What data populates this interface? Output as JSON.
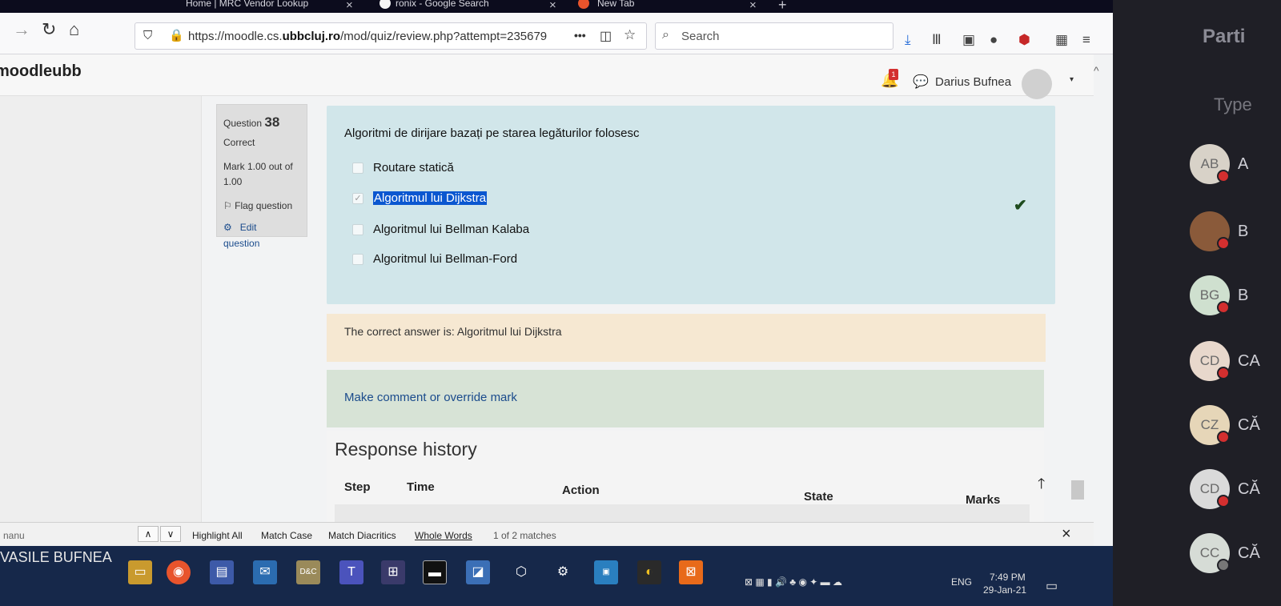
{
  "browser": {
    "tabs": [
      {
        "label": "Home | MRC Vendor Lookup"
      },
      {
        "label": "ronix - Google Search"
      },
      {
        "label": "New Tab"
      }
    ],
    "url_prefix": "https://moodle.cs.",
    "url_domain": "ubbcluj.ro",
    "url_suffix": "/mod/quiz/review.php?attempt=235679",
    "search_placeholder": "Search",
    "more_label": "•••"
  },
  "moodle": {
    "brand": "moodleubb",
    "user_name": "Darius Bufnea",
    "notification_count": "1"
  },
  "question_info": {
    "question_label": "Question",
    "question_number": "38",
    "state": "Correct",
    "mark_line1": "Mark 1.00 out of",
    "mark_line2": "1.00",
    "flag_label": "Flag question",
    "edit_line1": "Edit",
    "edit_line2": "question"
  },
  "question": {
    "text": "Algoritmi de dirijare bazați pe starea legăturilor folosesc",
    "answers": [
      {
        "label": "Routare statică",
        "checked": false
      },
      {
        "label": "Algoritmul lui Dijkstra",
        "checked": true
      },
      {
        "label": "Algoritmul lui Bellman Kalaba",
        "checked": false
      },
      {
        "label": "Algoritmul lui Bellman-Ford",
        "checked": false
      }
    ],
    "right_answer": "The correct answer is: Algoritmul lui Dijkstra",
    "comment_link": "Make comment or override mark"
  },
  "history": {
    "title": "Response history",
    "columns": [
      "Step",
      "Time",
      "Action",
      "State",
      "Marks"
    ]
  },
  "findbar": {
    "term": "nanu",
    "highlight_all": "Highlight All",
    "match_case": "Match Case",
    "match_diacritics": "Match Diacritics",
    "whole_words": "Whole Words",
    "status": "1 of 2 matches"
  },
  "taskbar": {
    "sharer_name": "VASILE BUFNEA",
    "language": "ENG",
    "time": "7:49 PM",
    "date": "29-Jan-21"
  },
  "participants": {
    "title": "Parti",
    "search_placeholder": "Type",
    "items": [
      {
        "initials": "AB",
        "name": "A"
      },
      {
        "initials": "",
        "name": "B"
      },
      {
        "initials": "BG",
        "name": "B"
      },
      {
        "initials": "CD",
        "name": "CA"
      },
      {
        "initials": "CZ",
        "name": "CĂ"
      },
      {
        "initials": "CD",
        "name": "CĂ"
      },
      {
        "initials": "CC",
        "name": "CĂ"
      }
    ]
  },
  "colors": {
    "formulation_bg": "#d1e6ea",
    "right_answer_bg": "#f6e8d2",
    "comment_bg": "#d7e3d6",
    "link": "#1a4b8c",
    "selection": "#0b57d0",
    "taskbar": "#16284a"
  }
}
